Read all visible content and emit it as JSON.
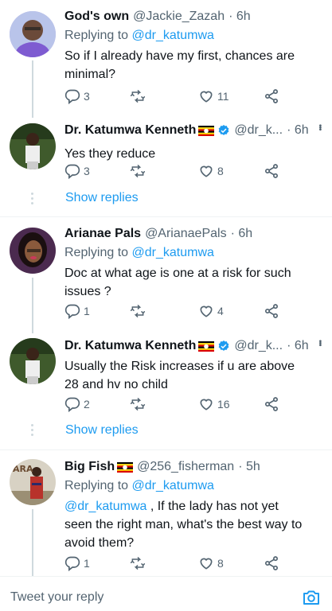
{
  "tweets": [
    {
      "name": "God's own",
      "handle": "@Jackie_Zazah",
      "time": "· 6h",
      "replying_prefix": "Replying to ",
      "replying_to": "@dr_katumwa",
      "text": "So if I already have my first,  chances are minimal?",
      "replies": "3",
      "likes": "11"
    },
    {
      "name": "Dr. Katumwa Kenneth",
      "handle": "@dr_k...",
      "time": "· 6h",
      "text": "Yes they reduce",
      "replies": "3",
      "likes": "8",
      "show_replies": "Show replies"
    },
    {
      "name": "Arianae Pals",
      "handle": "@ArianaePals",
      "time": "· 6h",
      "replying_prefix": "Replying to ",
      "replying_to": "@dr_katumwa",
      "text": "Doc at what age is one at a risk for such issues ?",
      "replies": "1",
      "likes": "4"
    },
    {
      "name": "Dr. Katumwa Kenneth",
      "handle": "@dr_k...",
      "time": "· 6h",
      "text": "Usually the Risk increases if u are above 28 and hv no child",
      "replies": "2",
      "likes": "16",
      "show_replies": "Show replies"
    },
    {
      "name": "Big Fish",
      "handle": "@256_fisherman",
      "time": "· 5h",
      "replying_prefix": "Replying to ",
      "replying_to": "@dr_katumwa",
      "text_mention": "@dr_katumwa",
      "text": " , If the lady has not yet seen the right man, what's the best way to avoid them?",
      "replies": "1",
      "likes": "8"
    }
  ],
  "composer": {
    "placeholder": "Tweet your reply"
  },
  "colors": {
    "link": "#1d9bf0",
    "secondary": "#536471",
    "verified": "#1d9bf0",
    "line": "#cfd9de"
  }
}
